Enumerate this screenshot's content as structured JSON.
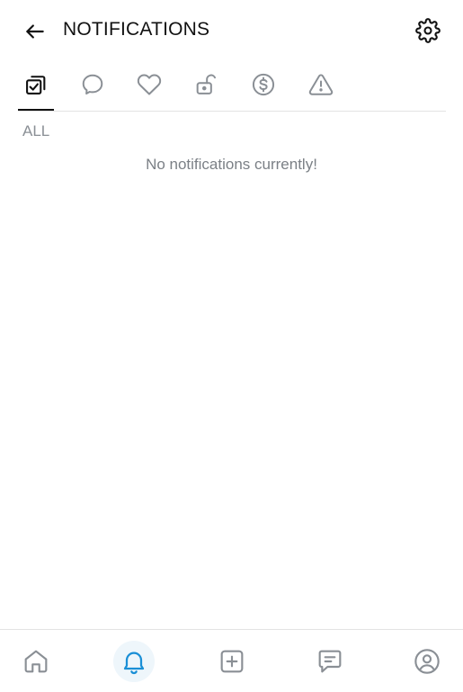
{
  "header": {
    "title": "NOTIFICATIONS",
    "back_icon": "arrow-left-icon",
    "settings_icon": "gear-icon"
  },
  "tabs": [
    {
      "id": "all",
      "icon": "checked-cards-icon",
      "active": true
    },
    {
      "id": "comments",
      "icon": "speech-bubble-icon",
      "active": false
    },
    {
      "id": "likes",
      "icon": "heart-icon",
      "active": false
    },
    {
      "id": "unlocks",
      "icon": "unlocked-padlock-icon",
      "active": false
    },
    {
      "id": "tips",
      "icon": "dollar-coin-icon",
      "active": false
    },
    {
      "id": "alerts",
      "icon": "warning-triangle-icon",
      "active": false
    }
  ],
  "section": {
    "label": "ALL"
  },
  "empty_state": {
    "message": "No notifications currently!"
  },
  "bottom_nav": [
    {
      "id": "home",
      "icon": "home-icon",
      "active": false
    },
    {
      "id": "notifications",
      "icon": "bell-icon",
      "active": true
    },
    {
      "id": "create",
      "icon": "plus-square-icon",
      "active": false
    },
    {
      "id": "messages",
      "icon": "message-icon",
      "active": false
    },
    {
      "id": "profile",
      "icon": "profile-icon",
      "active": false
    }
  ],
  "colors": {
    "text_primary": "#111111",
    "icon_gray": "#8a8f95",
    "accent_blue": "#1a8fd6",
    "active_bg": "#eef6fb",
    "divider": "#e3e3e3"
  }
}
